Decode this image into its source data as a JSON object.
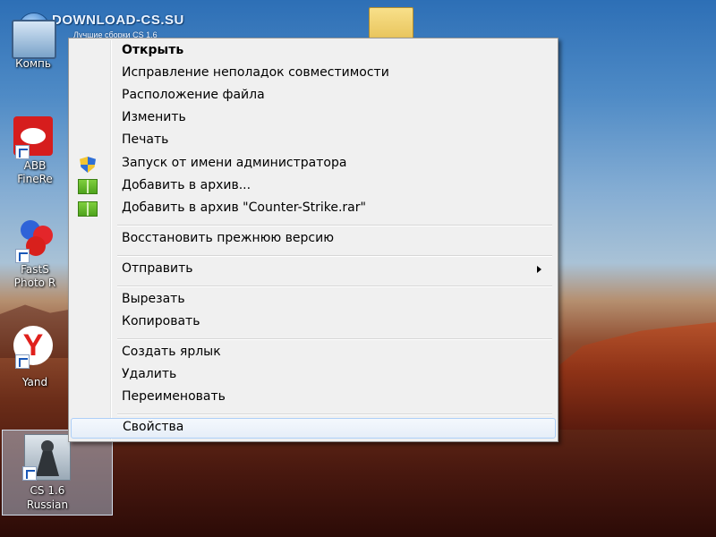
{
  "watermark": {
    "title": "DOWNLOAD-CS.SU",
    "subtitle": "Лучшие сборки CS 1.6"
  },
  "desktop": {
    "icons": [
      {
        "label": "Компь",
        "icon": "computer-icon"
      },
      {
        "label1": "ABB",
        "label2": "FineRe",
        "icon": "abbyy-finereader-icon"
      },
      {
        "label1": "FastS",
        "label2": "Photo R",
        "icon": "faststone-icon"
      },
      {
        "label": "Yand",
        "icon": "yandex-icon"
      },
      {
        "label1": "CS 1.6",
        "label2": "Russian",
        "icon": "counter-strike-icon"
      }
    ],
    "folder_icon": "folder-icon"
  },
  "context_menu": {
    "items": [
      {
        "label": "Открыть",
        "bold": true
      },
      {
        "label": "Исправление неполадок совместимости"
      },
      {
        "label": "Расположение файла"
      },
      {
        "label": "Изменить"
      },
      {
        "label": "Печать"
      },
      {
        "label": "Запуск от имени администратора",
        "icon": "uac-shield-icon"
      },
      {
        "label": "Добавить в архив...",
        "icon": "winrar-icon"
      },
      {
        "label": "Добавить в архив \"Counter-Strike.rar\"",
        "icon": "winrar-icon"
      },
      {
        "label": "Восстановить прежнюю версию"
      },
      {
        "label": "Отправить",
        "submenu": true
      },
      {
        "label": "Вырезать"
      },
      {
        "label": "Копировать"
      },
      {
        "label": "Создать ярлык"
      },
      {
        "label": "Удалить"
      },
      {
        "label": "Переименовать"
      },
      {
        "label": "Свойства",
        "highlighted": true
      }
    ]
  }
}
